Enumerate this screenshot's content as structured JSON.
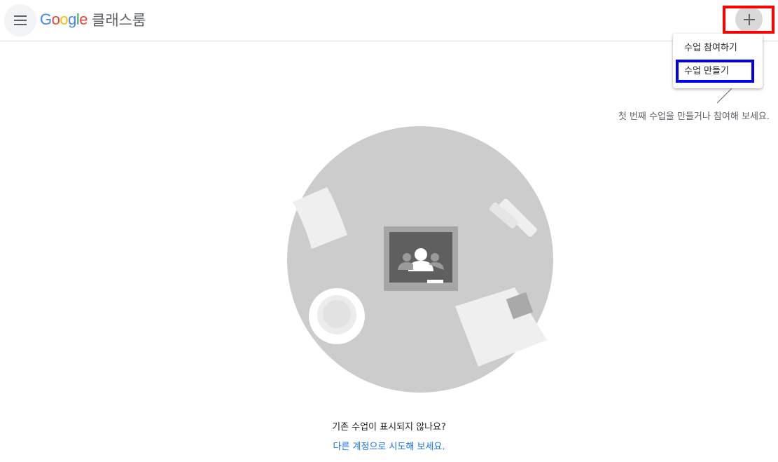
{
  "header": {
    "logo_text": [
      "G",
      "o",
      "o",
      "g",
      "l",
      "e"
    ],
    "app_name": "클래스룸",
    "menu_icon": "hamburger-menu-icon",
    "add_icon": "plus-icon"
  },
  "add_menu": {
    "items": [
      {
        "label": "수업 참여하기"
      },
      {
        "label": "수업 만들기"
      }
    ]
  },
  "hint": {
    "text": "첫 번째 수업을 만들거나 참여해 보세요."
  },
  "empty_state": {
    "question": "기존 수업이 표시되지 않나요?",
    "link": "다른 계정으로 시도해 보세요."
  },
  "colors": {
    "google_blue": "#4285F4",
    "google_red": "#EA4335",
    "google_yellow": "#FBBC05",
    "google_green": "#34A853",
    "link": "#1a73e8",
    "highlight_red": "#ff0000",
    "highlight_blue": "#0000ee"
  }
}
